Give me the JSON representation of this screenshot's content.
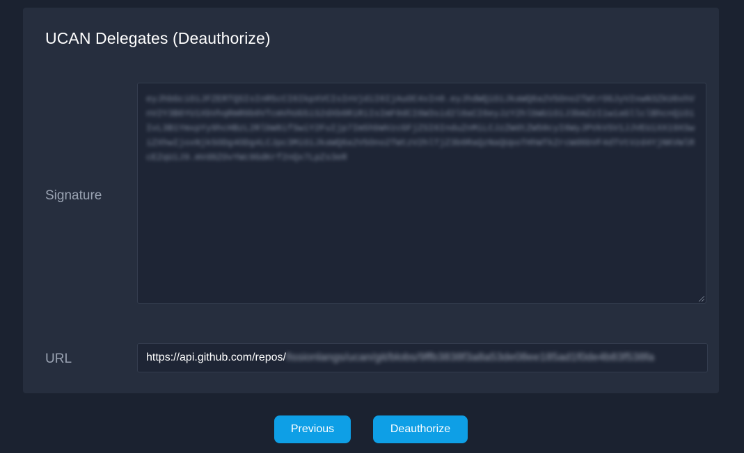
{
  "card": {
    "title": "UCAN Delegates (Deauthorize)"
  },
  "fields": {
    "signature": {
      "label": "Signature",
      "value": "eyJhbGciOiJFZERTQSIsInR5cCI6IkpXVCIsInVjdiI6IjAuOC4xIn0.eyJhdWQiOiJkaWQ6a2V5Ono2TWtrOGJyV2xwN3ZkU0xhVnV2Y3B6YU1XbVhqRmR0b0VTcmVhUG5iS2dXb0RiRiIsImF0dCI6W3sid2l0aCI6eyJzY2hlbWUiOiJ3bmZzIiwiaGllclBhcnQiOiIvL3B1YmxpYy9hcHBzL2RlbW8ifSwiY2FuIjp7Im5hbWVzcGFjZSI6InduZnMiLCJzZWdtZW50cyI6WyJPVkVSV1JJVEUiXX19XSwiZXhwIjoxNjk5ODg4ODg4LCJpc3MiOiJkaWQ6a2V5Ono2TWtzV2hlTjZ3b0RaQzNaQUpoTHhWTkZrcWd6bVF4dTVtVzd4YjNKVWlRcEZqUiJ9.mVd8ZOvYWc9GdKrf2nQx7LpZs3eR"
    },
    "url": {
      "label": "URL",
      "value_prefix": "https://api.github.com/repos/",
      "value_suffix": "fissionlangs/ucan/git/blobs/9ffb3838f3a8a53de08ee185ad1f0de4b83f538fa"
    }
  },
  "actions": {
    "previous_label": "Previous",
    "deauthorize_label": "Deauthorize"
  },
  "colors": {
    "background": "#1b2230",
    "card": "#262e3e",
    "input": "#1e2535",
    "accent": "#0e9fe6"
  }
}
